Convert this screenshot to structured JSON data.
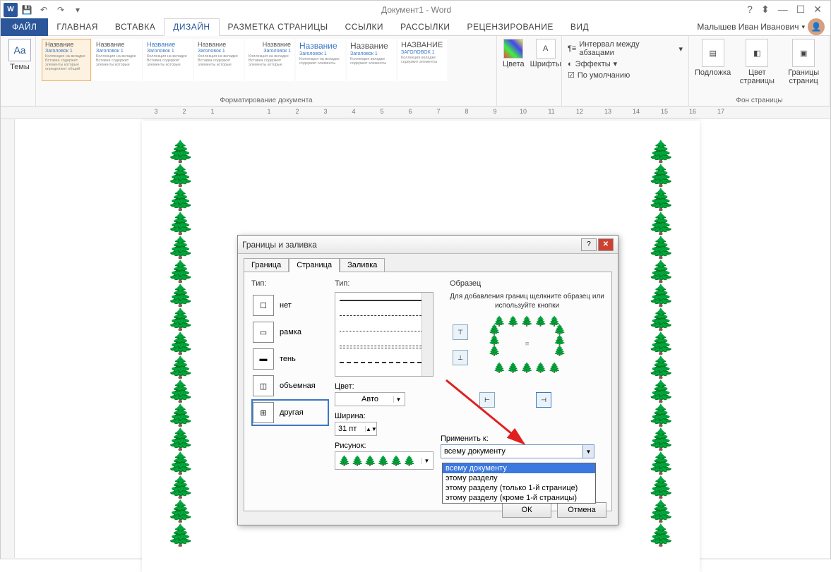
{
  "title": "Документ1 - Word",
  "user": "Малышев Иван Иванович",
  "tabs": [
    "ФАЙЛ",
    "ГЛАВНАЯ",
    "ВСТАВКА",
    "ДИЗАЙН",
    "РАЗМЕТКА СТРАНИЦЫ",
    "ССЫЛКИ",
    "РАССЫЛКИ",
    "РЕЦЕНЗИРОВАНИЕ",
    "ВИД"
  ],
  "active_tab": "ДИЗАЙН",
  "ribbon": {
    "themes": "Темы",
    "group_format": "Форматирование документа",
    "group_bg": "Фон страницы",
    "styles": [
      {
        "title": "Название",
        "sub": "Заголовок 1"
      },
      {
        "title": "Название",
        "sub": "Заголовок 1"
      },
      {
        "title": "Название",
        "sub": "Заголовок 1"
      },
      {
        "title": "Название",
        "sub": "Заголовок 1"
      },
      {
        "title": "Название",
        "sub": "Заголовок 1"
      },
      {
        "title": "Название",
        "sub": "Заголовок 1"
      },
      {
        "title": "Название",
        "sub": "Заголовок 1"
      },
      {
        "title": "НАЗВАНИЕ",
        "sub": "ЗАГОЛОВОК 1"
      }
    ],
    "colors": "Цвета",
    "fonts": "Шрифты",
    "spacing": "Интервал между абзацами",
    "effects": "Эффекты",
    "default": "По умолчанию",
    "watermark": "Подложка",
    "pagecolor": "Цвет страницы",
    "borders": "Границы страниц"
  },
  "dialog": {
    "title": "Границы и заливка",
    "tabs": [
      "Граница",
      "Страница",
      "Заливка"
    ],
    "active_tab": "Страница",
    "type_label": "Тип:",
    "types": [
      "нет",
      "рамка",
      "тень",
      "объемная",
      "другая"
    ],
    "style_label": "Тип:",
    "color_label": "Цвет:",
    "color_value": "Авто",
    "width_label": "Ширина:",
    "width_value": "31 пт",
    "picture_label": "Рисунок:",
    "preview_label": "Образец",
    "preview_hint": "Для добавления границ щелкните образец или используйте кнопки",
    "apply_label": "Применить к:",
    "apply_value": "всему документу",
    "apply_options": [
      "всему документу",
      "этому разделу",
      "этому разделу (только 1-й странице)",
      "этому разделу (кроме 1-й страницы)"
    ],
    "ok": "ОК",
    "cancel": "Отмена"
  }
}
